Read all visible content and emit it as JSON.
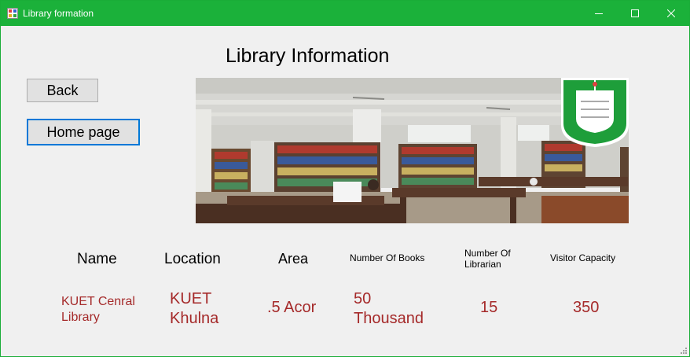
{
  "window": {
    "title": "Library formation",
    "icons": {
      "app": "app-window-icon",
      "minimize": "minimize-icon",
      "maximize": "maximize-icon",
      "close": "close-icon"
    }
  },
  "heading": "Library Information",
  "buttons": {
    "back": "Back",
    "home": "Home page"
  },
  "photo": {
    "subject": "library reading room photo",
    "logo": "university crest logo"
  },
  "table": {
    "headers": {
      "name": "Name",
      "location": "Location",
      "area": "Area",
      "books": "Number Of Books",
      "librarian": "Number Of Librarian",
      "capacity": "Visitor Capacity"
    },
    "values": {
      "name": "KUET Cenral Library",
      "location": "KUET Khulna",
      "area": ".5 Acor",
      "books": "50 Thousand",
      "librarian": "15",
      "capacity": "350"
    }
  },
  "colors": {
    "titlebar": "#1bb13a",
    "value_text": "#a52a2a",
    "accent_border": "#0078d7"
  }
}
